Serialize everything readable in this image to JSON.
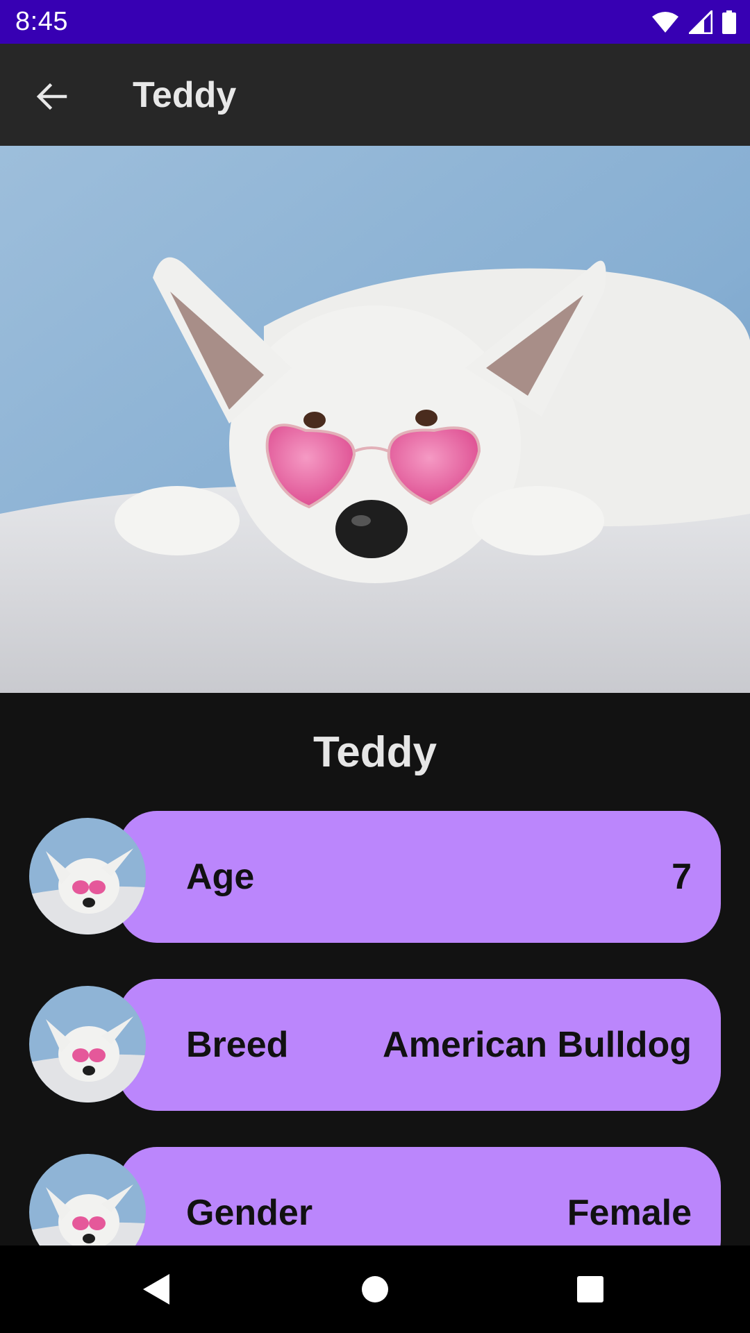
{
  "status_bar": {
    "time": "8:45",
    "icons": [
      "wifi-icon",
      "cell-signal-icon",
      "battery-icon"
    ],
    "color": "#3700b3"
  },
  "app_bar": {
    "back_icon": "arrow-back-icon",
    "title": "Teddy"
  },
  "hero": {
    "image": "white dog wearing pink heart-shaped sunglasses lying on white blanket"
  },
  "pet": {
    "name": "Teddy",
    "details": [
      {
        "label": "Age",
        "value": "7"
      },
      {
        "label": "Breed",
        "value": "American Bulldog"
      },
      {
        "label": "Gender",
        "value": "Female"
      }
    ]
  },
  "nav_bar": {
    "buttons": [
      "back-triangle-icon",
      "home-circle-icon",
      "recents-square-icon"
    ]
  },
  "colors": {
    "accent": "#bb86fc",
    "background": "#121212",
    "app_bar": "#272727"
  }
}
